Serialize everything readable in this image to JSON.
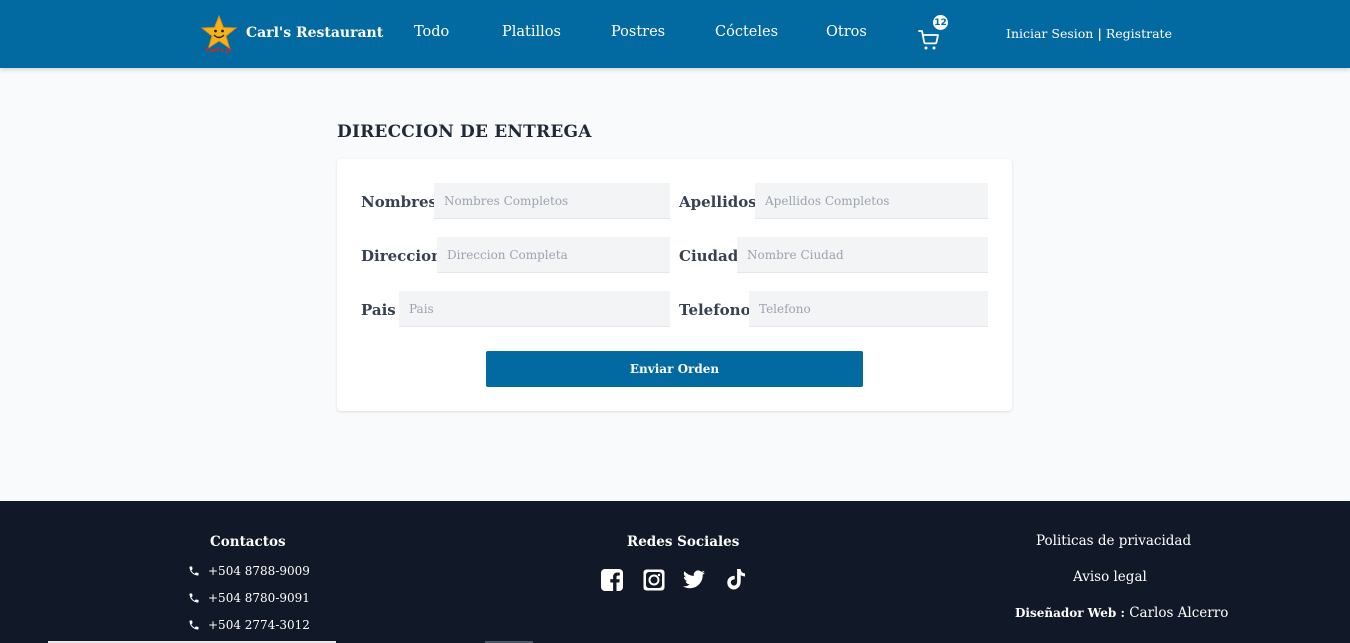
{
  "header": {
    "brand_name": "Carl's Restaurant",
    "brand_logo_text": "Carl's Jr.",
    "nav": [
      {
        "label": "Todo"
      },
      {
        "label": "Platillos"
      },
      {
        "label": "Postres"
      },
      {
        "label": "Cócteles"
      },
      {
        "label": "Otros"
      }
    ],
    "cart_count": "12",
    "login_label": "Iniciar Sesion",
    "separator": "|",
    "register_label": "Registrate"
  },
  "form": {
    "title": "DIRECCION DE ENTREGA",
    "fields": {
      "nombres": {
        "label": "Nombres",
        "placeholder": "Nombres Completos",
        "value": ""
      },
      "apellidos": {
        "label": "Apellidos",
        "placeholder": "Apellidos Completos",
        "value": ""
      },
      "direccion": {
        "label": "Direccion",
        "placeholder": "Direccion Completa",
        "value": ""
      },
      "ciudad": {
        "label": "Ciudad",
        "placeholder": "Nombre Ciudad",
        "value": ""
      },
      "pais": {
        "label": "Pais",
        "placeholder": "Pais",
        "value": ""
      },
      "telefono": {
        "label": "Telefono",
        "placeholder": "Telefono",
        "value": ""
      }
    },
    "submit_label": "Enviar Orden"
  },
  "footer": {
    "contacts_title": "Contactos",
    "phones": [
      "+504 8788-9009",
      "+504 8780-9091",
      "+504 2774-3012"
    ],
    "social_title": "Redes Sociales",
    "social_icons": [
      "facebook-icon",
      "instagram-icon",
      "twitter-icon",
      "tiktok-icon"
    ],
    "privacy_label": "Politicas de privacidad",
    "legal_label": "Aviso legal",
    "designer_label": "Diseñador Web :",
    "designer_name": "Carlos Alcerro"
  },
  "colors": {
    "primary": "#0369a1",
    "footer_bg": "#111827",
    "page_bg": "#f9fafb",
    "input_bg": "#f3f4f6"
  }
}
